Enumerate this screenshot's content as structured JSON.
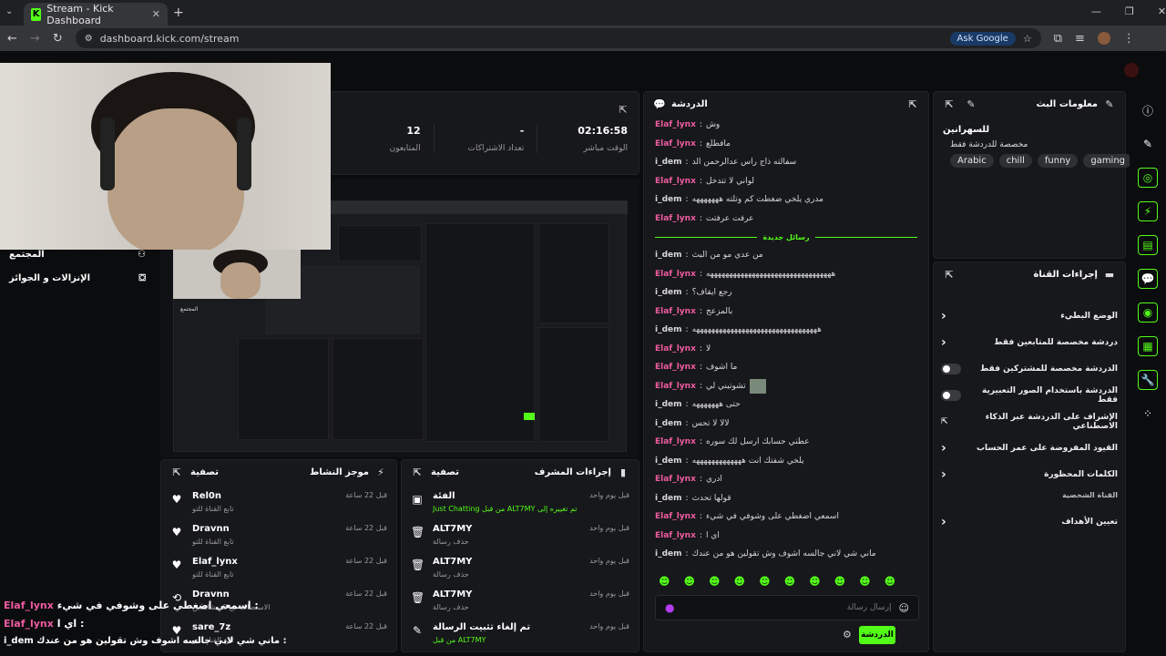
{
  "browser": {
    "tab_title": "Stream - Kick Dashboard",
    "url": "dashboard.kick.com/stream",
    "ask_google": "Ask Google"
  },
  "stats": [
    {
      "value": "12",
      "label": "المتابعون"
    },
    {
      "value": "-",
      "label": "تعداد الاشتراكات"
    },
    {
      "value": "02:16:58",
      "label": "الوقت مباشر"
    }
  ],
  "sidebar": {
    "community": "المجتمع",
    "rewards": "الإنزالات و الجوائز"
  },
  "chat": {
    "title": "الدردشة",
    "new_messages": "رسائل جديدة",
    "input_placeholder": "إرسال رسالة",
    "send_label": "الدردشة",
    "messages_before": [
      {
        "user": "Elaf_lynx",
        "text": "وش",
        "pink": true
      },
      {
        "user": "Elaf_lynx",
        "text": "مافطلع",
        "pink": true
      },
      {
        "user": "i_dem",
        "text": "سفالته ذاج راس عدالرحمن الد",
        "pink": false
      },
      {
        "user": "Elaf_lynx",
        "text": "لواني لا تتدخل",
        "pink": true
      },
      {
        "user": "i_dem",
        "text": "مدري يلخي ضغطت كم وتلته هههههههه",
        "pink": false
      },
      {
        "user": "Elaf_lynx",
        "text": "عرفت عرفتت",
        "pink": true
      }
    ],
    "messages_after": [
      {
        "user": "i_dem",
        "text": "من عدي مو من البث",
        "pink": false
      },
      {
        "user": "Elaf_lynx",
        "text": "هههههههههههههههههههههههههههههههههه",
        "pink": true
      },
      {
        "user": "i_dem",
        "text": "رجع ايقاف؟",
        "pink": false
      },
      {
        "user": "Elaf_lynx",
        "text": "بالمزعج",
        "pink": true
      },
      {
        "user": "i_dem",
        "text": "هههههههههههههههههههههههههههههههههه",
        "pink": false
      },
      {
        "user": "Elaf_lynx",
        "text": "لا",
        "pink": true
      },
      {
        "user": "Elaf_lynx",
        "text": "ما اشوف",
        "pink": true
      },
      {
        "user": "Elaf_lynx",
        "text": "تشوتيني لي",
        "pink": true
      },
      {
        "user": "i_dem",
        "text": "حتى هههههههه",
        "pink": false
      },
      {
        "user": "i_dem",
        "text": "لالا لا تحس",
        "pink": false
      },
      {
        "user": "Elaf_lynx",
        "text": "عطني حسابك ارسل لك سوره",
        "pink": true
      },
      {
        "user": "i_dem",
        "text": "يلخي شفتك انت هههههههههههههه",
        "pink": false
      },
      {
        "user": "Elaf_lynx",
        "text": "ادري",
        "pink": true
      },
      {
        "user": "i_dem",
        "text": "قولها تحدث",
        "pink": false
      },
      {
        "user": "Elaf_lynx",
        "text": "اسمعي اضغطي على وشوفي في شيء",
        "pink": true
      },
      {
        "user": "Elaf_lynx",
        "text": "اي ا",
        "pink": true
      },
      {
        "user": "i_dem",
        "text": "ماني شي لاني جالسه اشوف وش تقولين هو من عندك",
        "pink": false
      }
    ]
  },
  "activity": {
    "title": "موجز النشاط",
    "filter": "تصفية",
    "items": [
      {
        "name": "Rel0n",
        "sub": "تابع القناة للتو",
        "time": "قبل 22 ساعة",
        "icon": "heart-icon"
      },
      {
        "name": "Dravnn",
        "sub": "تابع القناة للتو",
        "time": "قبل 22 ساعة",
        "icon": "heart-icon"
      },
      {
        "name": "Elaf_lynx",
        "sub": "تابع القناة للتو",
        "time": "قبل 22 ساعة",
        "icon": "heart-icon"
      },
      {
        "name": "Dravnn",
        "sub": "الاستضاف مع 6 مشاهدين",
        "time": "قبل 22 ساعة",
        "icon": "host-icon"
      },
      {
        "name": "sare_7z",
        "sub": "تابع القناة للتو",
        "time": "قبل 22 ساعة",
        "icon": "heart-icon"
      }
    ]
  },
  "modactions": {
    "title": "إجراءات المشرف",
    "filter": "تصفية",
    "items": [
      {
        "name": "الفئة",
        "sub": "Just Chatting من قبل ALT7MY تم تغييره إلى",
        "time": "قبل يوم واحد",
        "icon": "category-icon"
      },
      {
        "name": "ALT7MY",
        "sub": "حذف رسالة",
        "time": "قبل يوم واحد",
        "icon": "trash-icon"
      },
      {
        "name": "ALT7MY",
        "sub": "حذف رسالة",
        "time": "قبل يوم واحد",
        "icon": "trash-icon"
      },
      {
        "name": "ALT7MY",
        "sub": "حذف رسالة",
        "time": "قبل يوم واحد",
        "icon": "trash-icon"
      },
      {
        "name": "تم إلغاء تثبيت الرسالة",
        "sub": "من قبل ALT7MY",
        "time": "قبل يوم واحد",
        "icon": "unpin-icon"
      }
    ]
  },
  "info": {
    "title": "معلومات البث",
    "stream_title": "للسهرانين",
    "subtitle": "مخصصة للدردشة فقط",
    "tags": [
      "Arabic",
      "chill",
      "funny",
      "gaming"
    ]
  },
  "channel": {
    "title": "إجراءات القناة",
    "rows": [
      {
        "label": "الوضع البطيء",
        "control": "chevron"
      },
      {
        "label": "دردشة مخصصة للمتابعين فقط",
        "control": "chevron"
      },
      {
        "label": "الدردشة مخصصة للمشتركين فقط",
        "control": "toggle"
      },
      {
        "label": "الدردشة باستخدام الصور التعبيرية فقط",
        "control": "toggle"
      },
      {
        "label": "الإشراف على الدردشة عبر الذكاء الاصطناعي",
        "control": "external"
      },
      {
        "label": "القيود المفروضة على عمر الحساب",
        "control": "chevron"
      },
      {
        "label": "الكلمات المحظورة",
        "control": "chevron"
      }
    ],
    "section_label": "القناة الشخصية",
    "goals": "تعيين الأهداف"
  },
  "overlay_chat": [
    {
      "user": "Elaf_lynx",
      "text": "اسمعي اضغطي على وشوفي في شيء :"
    },
    {
      "user": "Elaf_lynx",
      "text": "اي ا :"
    },
    {
      "user": "i_dem",
      "text": "ماني شي لاني جالسه اشوف وش تقولين هو من عندك :"
    }
  ],
  "colors": {
    "accent": "#53fc18",
    "pink": "#ef5ba1",
    "panel": "#17181b"
  }
}
